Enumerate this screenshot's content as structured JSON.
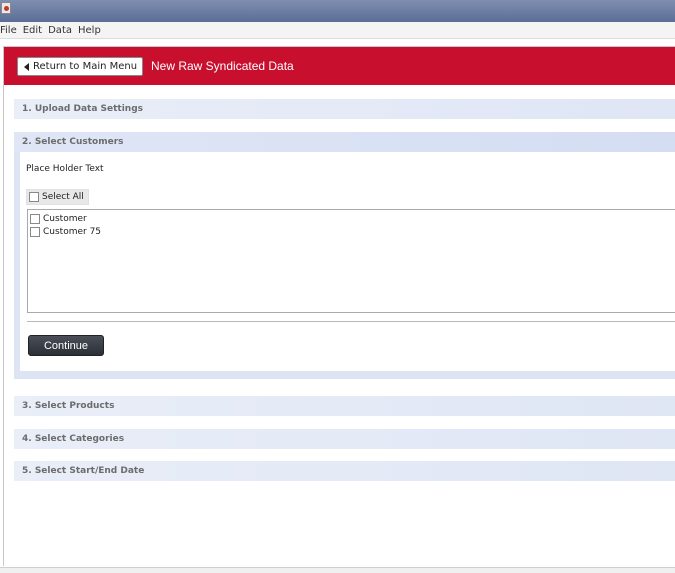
{
  "menu": {
    "file": "File",
    "edit": "Edit",
    "data": "Data",
    "help": "Help"
  },
  "header": {
    "return_label": "Return to Main Menu",
    "title": "New Raw Syndicated Data"
  },
  "sections": {
    "s1": "1. Upload Data Settings",
    "s2": "2. Select Customers",
    "s3": "3. Select Products",
    "s4": "4. Select Categories",
    "s5": "5. Select Start/End Date"
  },
  "customers": {
    "placeholder_text": "Place Holder Text",
    "select_all_label": "Select All",
    "items": [
      "Customer",
      "Customer 75"
    ],
    "continue_label": "Continue"
  },
  "icons": {
    "app": "app-icon",
    "return": "left-triangle-icon",
    "checkbox": "checkbox-icon"
  },
  "colors": {
    "header_red": "#c8102e",
    "section_bg": "#e4eaf6",
    "continue_bg": "#3a3e45"
  }
}
